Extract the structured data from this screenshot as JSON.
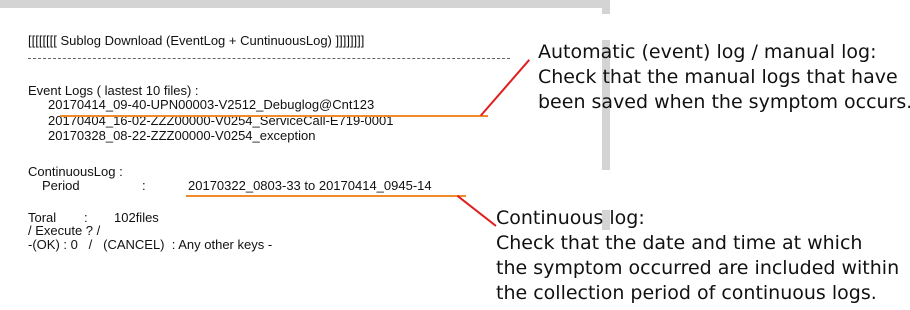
{
  "console": {
    "title": "[[[[[[[[ Sublog Download (EventLog + CuntinuousLog) ]]]]]]]]",
    "event_logs_label": "Event Logs ( lastest 10 files) :",
    "event_files": [
      "20170414_09-40-UPN00003-V2512_Debuglog@Cnt123",
      "20170404_16-02-ZZZ00000-V0254_ServiceCall-E719-0001",
      "20170328_08-22-ZZZ00000-V0254_exception"
    ],
    "continuous_label": "ContinuousLog :",
    "period_label": "Period",
    "period_sep": ":",
    "period_value": "20170322_0803-33 to 20170414_0945-14",
    "total_label": "Toral",
    "total_sep": ":",
    "total_value": "102files",
    "execute_prompt": "/ Execute ? /",
    "options_line": "-(OK) : 0   /   (CANCEL)  : Any other keys -"
  },
  "annotations": {
    "event_note": [
      "Automatic (event) log / manual log:",
      "Check that the manual logs that have",
      "been saved when the symptom occurs."
    ],
    "continuous_note": [
      "Continuous log:",
      "Check that the date and time at which",
      "the symptom occurred are included within",
      "the collection period of continuous logs."
    ]
  },
  "colors": {
    "highlight_underline": "#f08a2a",
    "leader_line": "#e02020",
    "frame": "#d4d4d4"
  }
}
